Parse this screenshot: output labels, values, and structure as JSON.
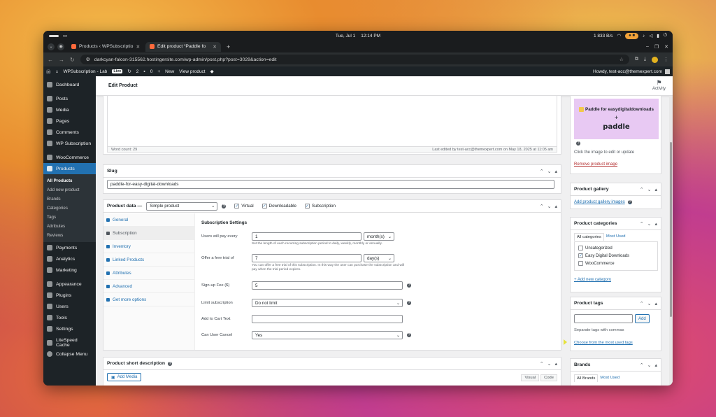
{
  "os": {
    "day": "Tue, Jul 1",
    "time": "12:14 PM",
    "net": "1 833 B/s"
  },
  "browser": {
    "tabs": [
      {
        "title": "Products ‹ WPSubscriptio",
        "active": false
      },
      {
        "title": "Edit product “Paddle fo",
        "active": true
      }
    ],
    "url": "darkcyan-falcon-315562.hostingersite.com/wp-admin/post.php?post=3029&action=edit"
  },
  "adminbar": {
    "site": "WPSubscription - Lab",
    "live": "Live",
    "updates": "2",
    "comments": "0",
    "new": "New",
    "view": "View product",
    "howdy": "Howdy, test-acc@themexpert.com"
  },
  "sidebar": {
    "items": [
      {
        "label": "Dashboard"
      },
      {
        "label": "Posts"
      },
      {
        "label": "Media"
      },
      {
        "label": "Pages"
      },
      {
        "label": "Comments"
      },
      {
        "label": "WP Subscription"
      },
      {
        "label": "WooCommerce"
      },
      {
        "label": "Products"
      },
      {
        "label": "Payments"
      },
      {
        "label": "Analytics"
      },
      {
        "label": "Marketing"
      },
      {
        "label": "Appearance"
      },
      {
        "label": "Plugins"
      },
      {
        "label": "Users"
      },
      {
        "label": "Tools"
      },
      {
        "label": "Settings"
      },
      {
        "label": "LiteSpeed Cache"
      },
      {
        "label": "Collapse Menu"
      }
    ],
    "products_sub": [
      "All Products",
      "Add new product",
      "Brands",
      "Categories",
      "Tags",
      "Attributes",
      "Reviews"
    ]
  },
  "page": {
    "title": "Edit Product",
    "activity": "Activity"
  },
  "editor": {
    "word_count": "Word count: 29",
    "last_edited": "Last edited by test-acc@themexpert.com on May 18, 2025 at 11:05 am"
  },
  "slug": {
    "title": "Slug",
    "value": "paddle-for-easy-digital-downloads"
  },
  "product_data": {
    "title": "Product data —",
    "type": "Simple product",
    "virtual": "Virtual",
    "downloadable": "Downloadable",
    "subscription": "Subscription",
    "tabs": [
      "General",
      "Subscription",
      "Inventory",
      "Linked Products",
      "Attributes",
      "Advanced",
      "Get more options"
    ],
    "panel_title": "Subscription Settings",
    "fields": {
      "pay_every_label": "Users will pay every",
      "pay_every_value": "1",
      "pay_every_unit": "month(s)",
      "pay_every_desc": "Set the length of each recurring subscription period to daily, weekly, monthly or annually.",
      "trial_label": "Offer a free trial of",
      "trial_value": "7",
      "trial_unit": "day(s)",
      "trial_desc": "You can offer a free trial of this subscription. In this way the user can purchase the subscription and will pay when the trial period expires.",
      "signup_label": "Sign-up Fee ($)",
      "signup_value": "5",
      "limit_label": "Limit subscription",
      "limit_value": "Do not limit",
      "cart_label": "Add to Cart Text",
      "cart_value": "",
      "cancel_label": "Can User Cancel",
      "cancel_value": "Yes"
    }
  },
  "short_desc": {
    "title": "Product short description",
    "add_media": "Add Media",
    "visual": "Visual",
    "code": "Code"
  },
  "product_image": {
    "line1": "Paddle for easydigitaldownloads",
    "plus": "+",
    "line2": "paddle",
    "edit_text": "Click the image to edit or update",
    "remove": "Remove product image"
  },
  "gallery": {
    "title": "Product gallery",
    "link": "Add product gallery images"
  },
  "categories": {
    "title": "Product categories",
    "tab_all": "All categories",
    "tab_most": "Most Used",
    "items": [
      {
        "label": "Uncategorized",
        "checked": false
      },
      {
        "label": "Easy Digital Downloads",
        "checked": true
      },
      {
        "label": "WooCommerce",
        "checked": false
      }
    ],
    "add_new": "+ Add new category"
  },
  "tags": {
    "title": "Product tags",
    "add": "Add",
    "separate": "Separate tags with commas",
    "choose": "Choose from the most used tags"
  },
  "brands": {
    "title": "Brands",
    "tab_all": "All Brands",
    "tab_most": "Most Used"
  }
}
